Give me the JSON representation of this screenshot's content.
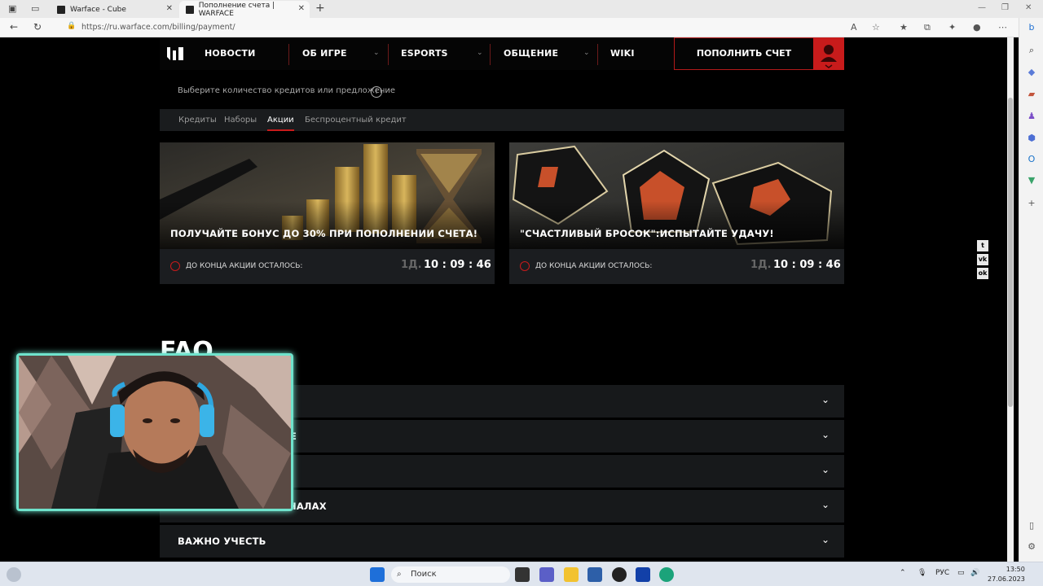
{
  "browser": {
    "tabs": [
      {
        "title": "Warface - Cube"
      },
      {
        "title": "Пополнение счета | WARFACE"
      }
    ],
    "url": "https://ru.warface.com/billing/payment/"
  },
  "site": {
    "nav": {
      "items": [
        "НОВОСТИ",
        "ОБ ИГРЕ",
        "ESPORTS",
        "ОБЩЕНИЕ",
        "WIKI"
      ],
      "topup_label": "ПОПОЛНИТЬ СЧЕТ"
    },
    "hint": "Выберите количество кредитов или предложение",
    "section_tabs": [
      "Кредиты",
      "Наборы",
      "Акции",
      "Беспроцентный кредит"
    ],
    "active_tab": "Акции",
    "promos": [
      {
        "title": "ПОЛУЧАЙТЕ БОНУС ДО 30% ПРИ ПОПОЛНЕНИИ СЧЕТА!",
        "timer_label": "ДО КОНЦА АКЦИИ ОСТАЛОСЬ:",
        "days": "1Д.",
        "time": "10 : 09 : 46"
      },
      {
        "title": "\"СЧАСТЛИВЫЙ БРОСОК\":ИСПЫТАЙТЕ УДАЧУ!",
        "timer_label": "ДО КОНЦА АКЦИИ ОСТАЛОСЬ:",
        "days": "1Д.",
        "time": "10 : 09 : 46"
      }
    ],
    "faq": {
      "title": "FAQ",
      "rows": [
        "",
        "Е",
        "",
        "НАЛАХ",
        "ВАЖНО УЧЕСТЬ"
      ]
    },
    "social": [
      "t",
      "vk",
      "ok"
    ]
  },
  "taskbar": {
    "search_placeholder": "Поиск",
    "lang": "РУС",
    "time": "13:50",
    "date": "27.06.2023"
  },
  "colors": {
    "accent_red": "#c81b1b",
    "webcam_border": "#6fe3cc"
  }
}
